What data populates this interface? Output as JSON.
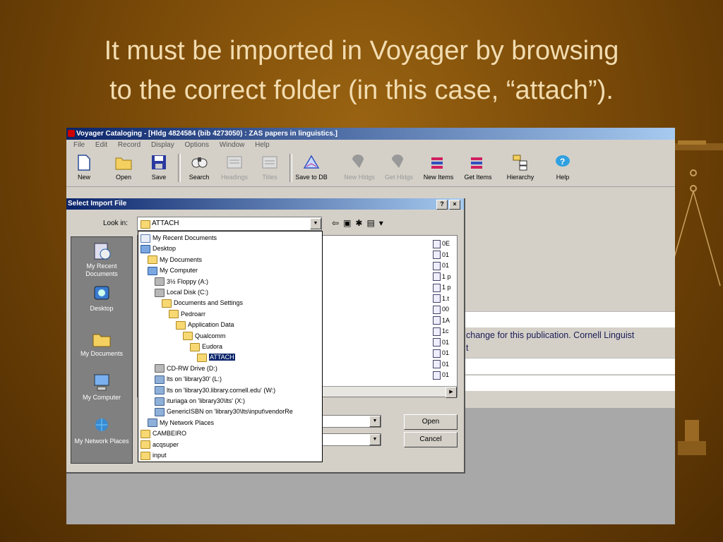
{
  "slide": {
    "title_line1": "It must be imported in Voyager by browsing",
    "title_line2": "to the correct folder (in this case, “attach”)."
  },
  "window": {
    "title": "Voyager Cataloging - [Hldg 4824584 (bib 4273050) : ZAS papers in linguistics.]",
    "menu": [
      "File",
      "Edit",
      "Record",
      "Display",
      "Options",
      "Window",
      "Help"
    ],
    "toolbar": [
      {
        "label": "New",
        "icon": "new-document-icon",
        "enabled": true
      },
      {
        "label": "Open",
        "icon": "open-folder-icon",
        "enabled": true
      },
      {
        "label": "Save",
        "icon": "save-disk-icon",
        "enabled": true
      },
      {
        "label": "Search",
        "icon": "search-binoculars-icon",
        "enabled": true
      },
      {
        "label": "Headings",
        "icon": "headings-icon",
        "enabled": false
      },
      {
        "label": "Titles",
        "icon": "titles-icon",
        "enabled": false
      },
      {
        "label": "Save to DB",
        "icon": "save-to-db-icon",
        "enabled": true
      },
      {
        "label": "New Hldgs",
        "icon": "new-holdings-icon",
        "enabled": false
      },
      {
        "label": "Get Hldgs",
        "icon": "get-holdings-icon",
        "enabled": false
      },
      {
        "label": "New Items",
        "icon": "new-items-icon",
        "enabled": true
      },
      {
        "label": "Get Items",
        "icon": "get-items-icon",
        "enabled": true
      },
      {
        "label": "Hierarchy",
        "icon": "hierarchy-icon",
        "enabled": true
      },
      {
        "label": "Help",
        "icon": "help-icon",
        "enabled": true
      }
    ],
    "background_text_line1": "change for this publication. Cornell Linguist",
    "background_text_line2": "t"
  },
  "dialog": {
    "title": "Select Import File",
    "help_button": "?",
    "close_button": "×",
    "look_in_label": "Look in:",
    "look_in_value": "ATTACH",
    "places": [
      {
        "label": "My Recent Documents",
        "icon": "recent-documents-icon"
      },
      {
        "label": "Desktop",
        "icon": "desktop-icon"
      },
      {
        "label": "My Documents",
        "icon": "my-documents-icon"
      },
      {
        "label": "My Computer",
        "icon": "my-computer-icon"
      },
      {
        "label": "My Network Places",
        "icon": "network-places-icon"
      }
    ],
    "dropdown_items": [
      {
        "label": "My Recent Documents",
        "indent": 0,
        "type": "doc"
      },
      {
        "label": "Desktop",
        "indent": 0,
        "type": "comp"
      },
      {
        "label": "My Documents",
        "indent": 1,
        "type": "folder"
      },
      {
        "label": "My Computer",
        "indent": 1,
        "type": "comp"
      },
      {
        "label": "3½ Floppy (A:)",
        "indent": 2,
        "type": "drive"
      },
      {
        "label": "Local Disk (C:)",
        "indent": 2,
        "type": "drive"
      },
      {
        "label": "Documents and Settings",
        "indent": 3,
        "type": "folder"
      },
      {
        "label": "Pedroarr",
        "indent": 4,
        "type": "folder"
      },
      {
        "label": "Application Data",
        "indent": 5,
        "type": "folder"
      },
      {
        "label": "Qualcomm",
        "indent": 6,
        "type": "folder"
      },
      {
        "label": "Eudora",
        "indent": 7,
        "type": "folder"
      },
      {
        "label": "ATTACH",
        "indent": 8,
        "type": "folder",
        "selected": true
      },
      {
        "label": "CD-RW Drive (D:)",
        "indent": 2,
        "type": "drive"
      },
      {
        "label": "lts on 'library30' (L:)",
        "indent": 2,
        "type": "net"
      },
      {
        "label": "lts on 'library30.library.cornell.edu' (W:)",
        "indent": 2,
        "type": "net"
      },
      {
        "label": "ituriaga on 'library30\\lts' (X:)",
        "indent": 2,
        "type": "net"
      },
      {
        "label": "GenericISBN on 'library30\\lts\\input\\vendorRe",
        "indent": 2,
        "type": "net"
      },
      {
        "label": "My Network Places",
        "indent": 1,
        "type": "net"
      },
      {
        "label": "CAMBEIRO",
        "indent": 0,
        "type": "folder"
      },
      {
        "label": "acqsuper",
        "indent": 0,
        "type": "folder"
      },
      {
        "label": "input",
        "indent": 0,
        "type": "folder"
      }
    ],
    "files": [
      "0E",
      "01",
      "01",
      "1 p",
      "1 p",
      "1.t",
      "00",
      "1A",
      "1c",
      "01",
      "01",
      "01",
      "01"
    ],
    "open_button": "Open",
    "cancel_button": "Cancel"
  },
  "colors": {
    "slide_background": "#7a4a08",
    "title_text": "#f2dcb0",
    "titlebar_start": "#0a246a",
    "titlebar_end": "#a6caf0",
    "selection": "#0a246a"
  }
}
